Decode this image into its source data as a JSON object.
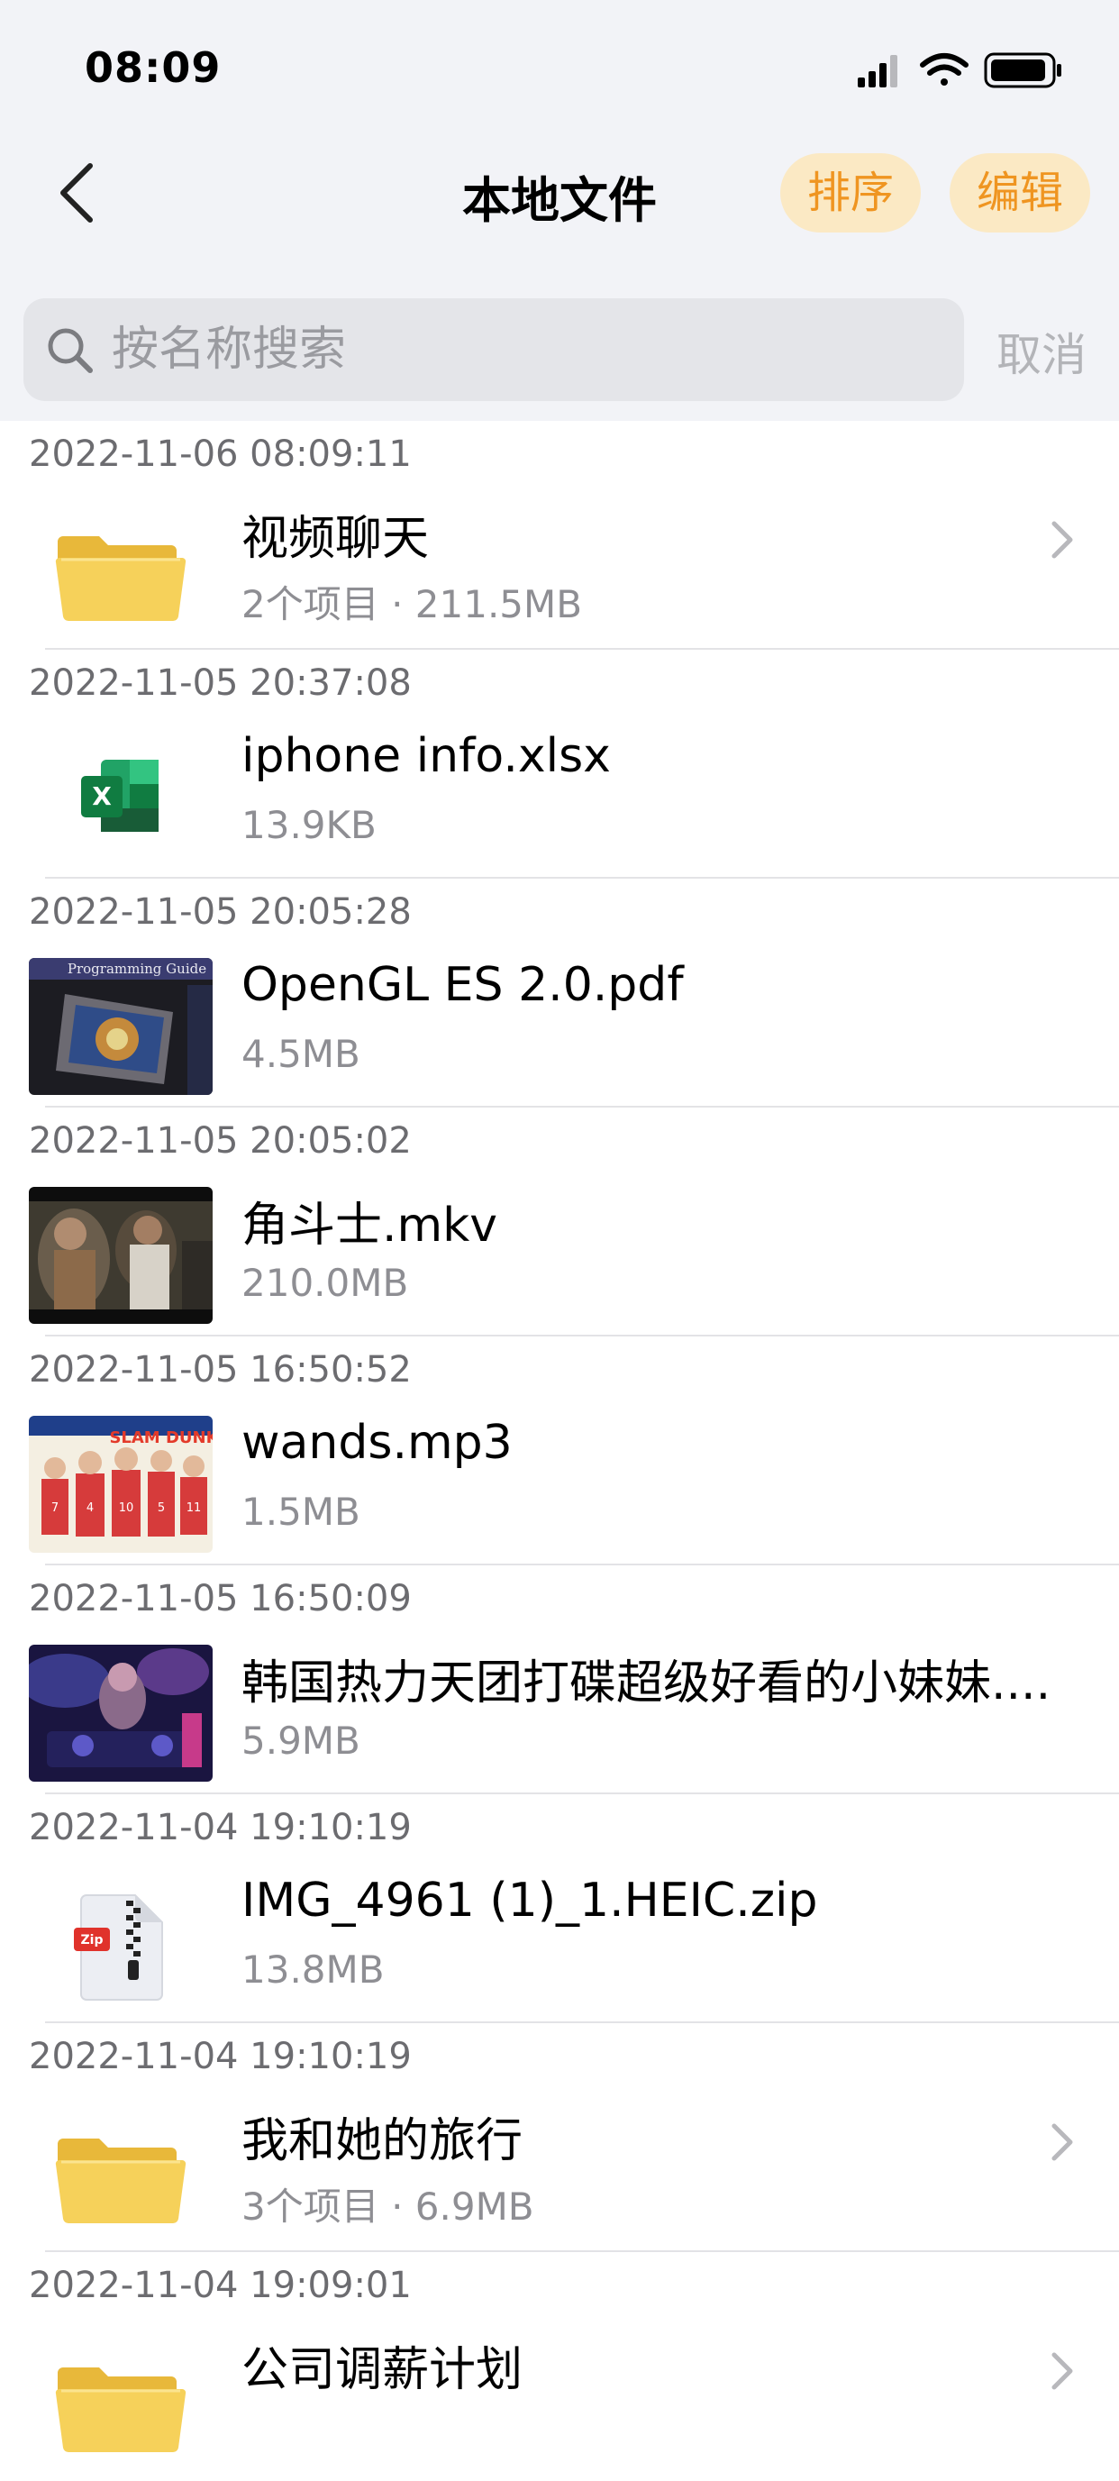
{
  "status": {
    "time": "08:09"
  },
  "header": {
    "title": "本地文件",
    "sort_label": "排序",
    "edit_label": "编辑"
  },
  "search": {
    "placeholder": "按名称搜索",
    "value": "",
    "cancel_label": "取消"
  },
  "colors": {
    "accent": "#ef9521",
    "accent_bg": "#fbe9c4",
    "header_bg": "#f2f3f7"
  },
  "files": [
    {
      "date": "2022-11-06 08:09:11",
      "name": "视频聊天",
      "meta": "2个项目 · 211.5MB",
      "icon": "folder-icon"
    },
    {
      "date": "2022-11-05 20:37:08",
      "name": "iphone info.xlsx",
      "meta": "13.9KB",
      "icon": "excel-icon"
    },
    {
      "date": "2022-11-05 20:05:28",
      "name": "OpenGL ES 2.0.pdf",
      "meta": "4.5MB",
      "icon": "pdf-thumbnail",
      "thumb_caption": "Programming Guide"
    },
    {
      "date": "2022-11-05 20:05:02",
      "name": "角斗士.mkv",
      "meta": "210.0MB",
      "icon": "video-thumbnail"
    },
    {
      "date": "2022-11-05 16:50:52",
      "name": "wands.mp3",
      "meta": "1.5MB",
      "icon": "album-art-thumbnail",
      "thumb_caption": "SLAM DUNK"
    },
    {
      "date": "2022-11-05 16:50:09",
      "name": "韩国热力天团打碟超级好看的小妹妹....",
      "meta": "5.9MB",
      "icon": "video-thumbnail"
    },
    {
      "date": "2022-11-04 19:10:19",
      "name": "IMG_4961 (1)_1.HEIC.zip",
      "meta": "13.8MB",
      "icon": "zip-icon",
      "thumb_caption": "Zip"
    },
    {
      "date": "2022-11-04 19:10:19",
      "name": "我和她的旅行",
      "meta": "3个项目 · 6.9MB",
      "icon": "folder-icon"
    },
    {
      "date": "2022-11-04 19:09:01",
      "name": "公司调薪计划",
      "meta": "",
      "icon": "folder-icon"
    }
  ]
}
